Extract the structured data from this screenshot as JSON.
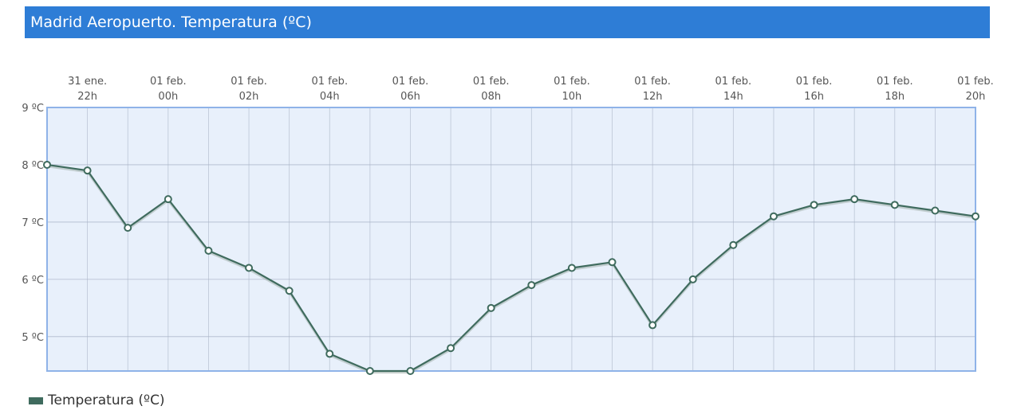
{
  "header": {
    "title": "Madrid Aeropuerto. Temperatura (ºC)"
  },
  "colors": {
    "header_bg": "#2e7dd6",
    "plot_bg": "#e8f0fb",
    "plot_border": "#8fb3e8",
    "series": "#3f6b5e",
    "grid": "#aab4c6"
  },
  "chart_data": {
    "type": "line",
    "title": "Madrid Aeropuerto. Temperatura (ºC)",
    "x_ticks": [
      {
        "date": "31 ene.",
        "hour": "22h"
      },
      {
        "date": "01 feb.",
        "hour": "00h"
      },
      {
        "date": "01 feb.",
        "hour": "02h"
      },
      {
        "date": "01 feb.",
        "hour": "04h"
      },
      {
        "date": "01 feb.",
        "hour": "06h"
      },
      {
        "date": "01 feb.",
        "hour": "08h"
      },
      {
        "date": "01 feb.",
        "hour": "10h"
      },
      {
        "date": "01 feb.",
        "hour": "12h"
      },
      {
        "date": "01 feb.",
        "hour": "14h"
      },
      {
        "date": "01 feb.",
        "hour": "16h"
      },
      {
        "date": "01 feb.",
        "hour": "18h"
      },
      {
        "date": "01 feb.",
        "hour": "20h"
      }
    ],
    "x": [
      "31 ene. 21h",
      "31 ene. 22h",
      "31 ene. 23h",
      "01 feb. 00h",
      "01 feb. 01h",
      "01 feb. 02h",
      "01 feb. 03h",
      "01 feb. 04h",
      "01 feb. 05h",
      "01 feb. 06h",
      "01 feb. 07h",
      "01 feb. 08h",
      "01 feb. 09h",
      "01 feb. 10h",
      "01 feb. 11h",
      "01 feb. 12h",
      "01 feb. 13h",
      "01 feb. 14h",
      "01 feb. 15h",
      "01 feb. 16h",
      "01 feb. 17h",
      "01 feb. 18h",
      "01 feb. 19h",
      "01 feb. 20h"
    ],
    "series": [
      {
        "name": "Temperatura (ºC)",
        "values": [
          8.0,
          7.9,
          6.9,
          7.4,
          6.5,
          6.2,
          5.8,
          4.7,
          4.4,
          4.4,
          4.8,
          5.5,
          5.9,
          6.2,
          6.3,
          5.2,
          6.0,
          6.6,
          7.1,
          7.3,
          7.4,
          7.3,
          7.2,
          7.1
        ]
      }
    ],
    "y_ticks": [
      "9 ºC",
      "8 ºC",
      "7 ºC",
      "6 ºC",
      "5 ºC"
    ],
    "y_tick_values": [
      9,
      8,
      7,
      6,
      5
    ],
    "ylim": [
      4.4,
      9
    ],
    "grid": true,
    "legend_position": "bottom-left"
  }
}
